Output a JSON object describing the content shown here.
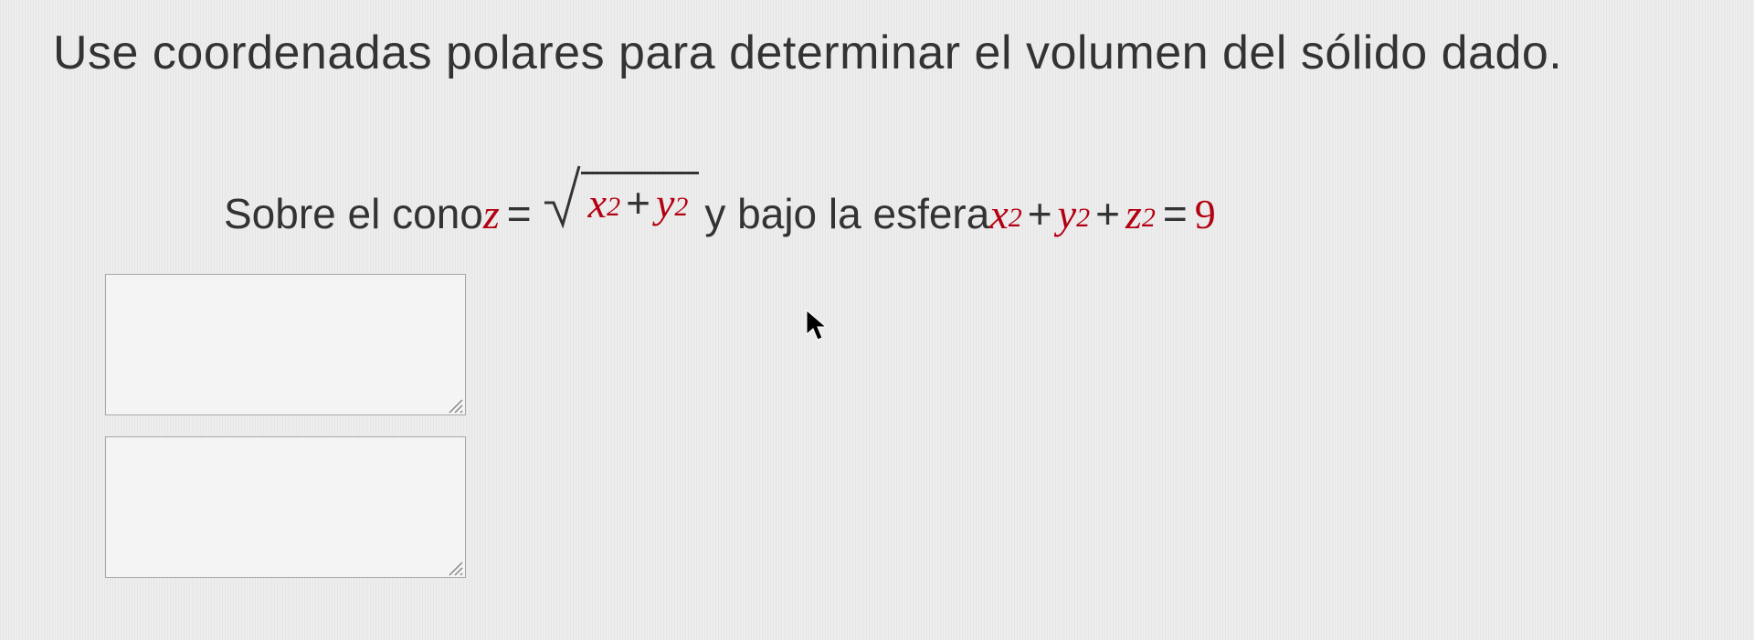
{
  "question": {
    "prompt": "Use coordenadas polares para determinar el volumen del sólido dado.",
    "line_prefix": "Sobre el cono ",
    "cone_var": "z",
    "eq_sign": "=",
    "radicand_x": "x",
    "radicand_y": "y",
    "exp2": "2",
    "plus": "+",
    "line_mid": " y bajo la esfera ",
    "sphere_x": "x",
    "sphere_y": "y",
    "sphere_z": "z",
    "sphere_rhs": "9"
  },
  "inputs": {
    "answer1_value": "",
    "answer1_placeholder": "",
    "answer2_value": "",
    "answer2_placeholder": ""
  }
}
